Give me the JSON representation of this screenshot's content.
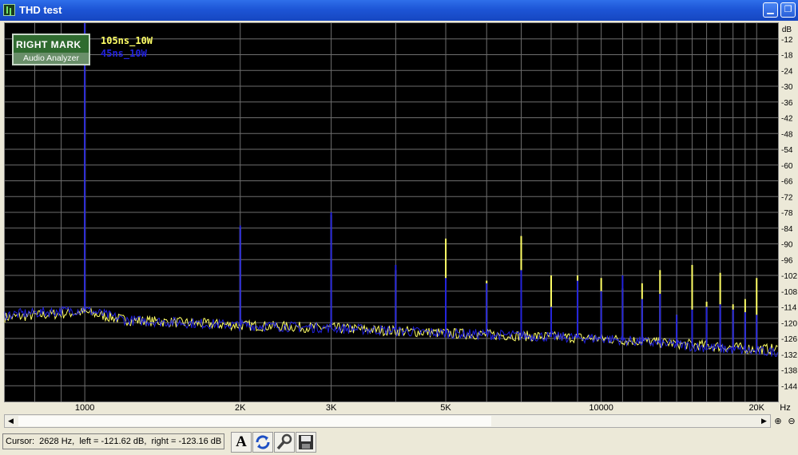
{
  "window": {
    "title": "THD test"
  },
  "logo": {
    "line1": "RIGHT MARK",
    "line2": "Audio Analyzer"
  },
  "status": {
    "cursor_text": "Cursor:  2628 Hz,  left = -121.62 dB,  right = -123.16 dB"
  },
  "colors": {
    "series_a": "#ffff66",
    "series_b": "#2222dd",
    "grid": "#6e6e6e",
    "background": "#000000"
  },
  "icons": {
    "minimize": "minimize-icon",
    "restore": "restore-icon",
    "zoom_in": "zoom-in-icon",
    "zoom_out": "zoom-out-icon",
    "font": "font-icon",
    "refresh": "refresh-icon",
    "settings": "wrench-icon",
    "save": "save-icon"
  },
  "chart_data": {
    "type": "line",
    "x_scale": "log",
    "xlim": [
      700,
      22000
    ],
    "ylim": [
      -150,
      -6
    ],
    "xlabel": "Hz",
    "ylabel": "dB",
    "grid": true,
    "legend_position": "top-left",
    "x_ticks": [
      {
        "value": 1000,
        "label": "1000"
      },
      {
        "value": 2000,
        "label": "2K"
      },
      {
        "value": 3000,
        "label": "3K"
      },
      {
        "value": 5000,
        "label": "5K"
      },
      {
        "value": 10000,
        "label": "10000"
      },
      {
        "value": 20000,
        "label": "20K"
      }
    ],
    "y_ticks": [
      -12,
      -18,
      -24,
      -30,
      -36,
      -42,
      -48,
      -54,
      -60,
      -66,
      -72,
      -78,
      -84,
      -90,
      -96,
      -102,
      -108,
      -114,
      -120,
      -126,
      -132,
      -138,
      -144
    ],
    "series": [
      {
        "name": "105ns_10W",
        "color": "#ffff66",
        "noise_floor": [
          [
            700,
            -118
          ],
          [
            1000,
            -116
          ],
          [
            1200,
            -119
          ],
          [
            2000,
            -121
          ],
          [
            3000,
            -122
          ],
          [
            5000,
            -124
          ],
          [
            10000,
            -126
          ],
          [
            20000,
            -130
          ]
        ],
        "peaks": [
          [
            1000,
            -6
          ],
          [
            2000,
            -84
          ],
          [
            3000,
            -79
          ],
          [
            4000,
            -100
          ],
          [
            5000,
            -88
          ],
          [
            6000,
            -104
          ],
          [
            7000,
            -87
          ],
          [
            8000,
            -102
          ],
          [
            9000,
            -102
          ],
          [
            10000,
            -103
          ],
          [
            11000,
            -107
          ],
          [
            12000,
            -105
          ],
          [
            13000,
            -100
          ],
          [
            14000,
            -117
          ],
          [
            15000,
            -98
          ],
          [
            16000,
            -112
          ],
          [
            17000,
            -101
          ],
          [
            18000,
            -113
          ],
          [
            19000,
            -111
          ],
          [
            20000,
            -103
          ]
        ]
      },
      {
        "name": "45ns_10W",
        "color": "#2222dd",
        "noise_floor": [
          [
            700,
            -117
          ],
          [
            1000,
            -115
          ],
          [
            1200,
            -119
          ],
          [
            2000,
            -121
          ],
          [
            3000,
            -122
          ],
          [
            5000,
            -124
          ],
          [
            10000,
            -126
          ],
          [
            20000,
            -131
          ]
        ],
        "peaks": [
          [
            1000,
            -6
          ],
          [
            2000,
            -83
          ],
          [
            3000,
            -78
          ],
          [
            4000,
            -98
          ],
          [
            5000,
            -103
          ],
          [
            6000,
            -105
          ],
          [
            7000,
            -100
          ],
          [
            8000,
            -114
          ],
          [
            9000,
            -104
          ],
          [
            10000,
            -108
          ],
          [
            11000,
            -102
          ],
          [
            12000,
            -111
          ],
          [
            13000,
            -109
          ],
          [
            14000,
            -117
          ],
          [
            15000,
            -115
          ],
          [
            16000,
            -114
          ],
          [
            17000,
            -113
          ],
          [
            18000,
            -115
          ],
          [
            19000,
            -116
          ],
          [
            20000,
            -117
          ]
        ]
      }
    ]
  }
}
